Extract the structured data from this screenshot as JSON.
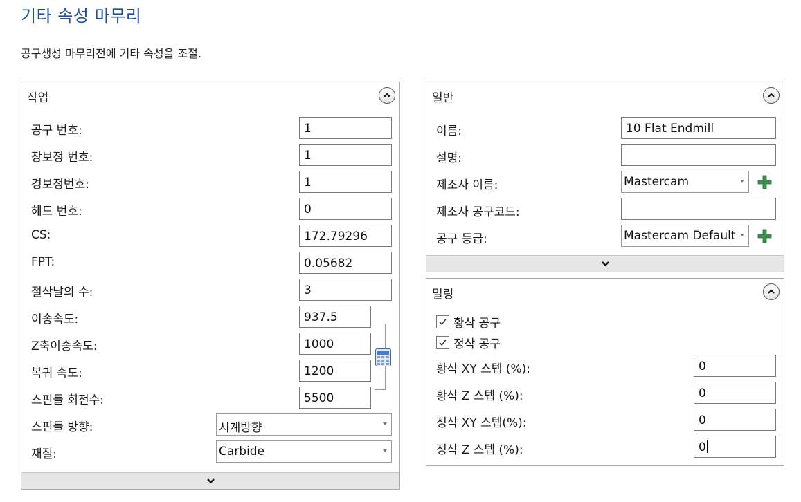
{
  "page": {
    "title": "기타 속성 마무리",
    "subtitle": "공구생성 마무리전에 기타 속성을 조절."
  },
  "work_panel": {
    "title": "작업",
    "fields": {
      "tool_number": {
        "label": "공구 번호:",
        "value": "1"
      },
      "length_offset": {
        "label": "장보정 번호:",
        "value": "1"
      },
      "dia_offset": {
        "label": "경보정번호:",
        "value": "1"
      },
      "head_number": {
        "label": "헤드 번호:",
        "value": "0"
      },
      "cs": {
        "label": "CS:",
        "value": "172.79296"
      },
      "fpt": {
        "label": "FPT:",
        "value": "0.05682"
      },
      "flutes": {
        "label": "절삭날의 수:",
        "value": "3"
      },
      "feed_rate": {
        "label": "이송속도:",
        "value": "937.5"
      },
      "plunge_rate": {
        "label": "Z축이송속도:",
        "value": "1000"
      },
      "retract_rate": {
        "label": "복귀 속도:",
        "value": "1200"
      },
      "spindle_speed": {
        "label": "스핀들 회전수:",
        "value": "5500"
      },
      "spindle_direction": {
        "label": "스핀들 방향:",
        "value": "시계방향"
      },
      "material": {
        "label": "재질:",
        "value": "Carbide"
      }
    },
    "icons": {
      "calculator": "calculator-icon",
      "collapse": "chevron-up-icon",
      "expand": "chevron-down-icon"
    }
  },
  "general_panel": {
    "title": "일반",
    "fields": {
      "name": {
        "label": "이름:",
        "value": "10 Flat Endmill"
      },
      "description": {
        "label": "설명:",
        "value": ""
      },
      "manufacturer": {
        "label": "제조사 이름:",
        "value": "Mastercam"
      },
      "manufacturer_code": {
        "label": "제조사 공구코드:",
        "value": ""
      },
      "tool_grade": {
        "label": "공구 등급:",
        "value": "Mastercam Default"
      }
    },
    "icons": {
      "add": "plus-icon",
      "accent": "#3f8f4f"
    }
  },
  "milling_panel": {
    "title": "밀링",
    "checkboxes": {
      "rough_tool": {
        "label": "황삭 공구",
        "checked": true
      },
      "finish_tool": {
        "label": "정삭 공구",
        "checked": true
      }
    },
    "fields": {
      "rough_xy": {
        "label": "황삭 XY 스텝 (%):",
        "value": "0"
      },
      "rough_z": {
        "label": "황삭 Z 스텝 (%):",
        "value": "0"
      },
      "finish_xy": {
        "label": "정삭 XY 스텝(%):",
        "value": "0"
      },
      "finish_z": {
        "label": "정삭 Z 스텝 (%):",
        "value": "0"
      }
    }
  },
  "colors": {
    "title_blue": "#1f4e9c",
    "expander_gray": "#e6e6e6",
    "plus_green": "#3f8f4f"
  }
}
